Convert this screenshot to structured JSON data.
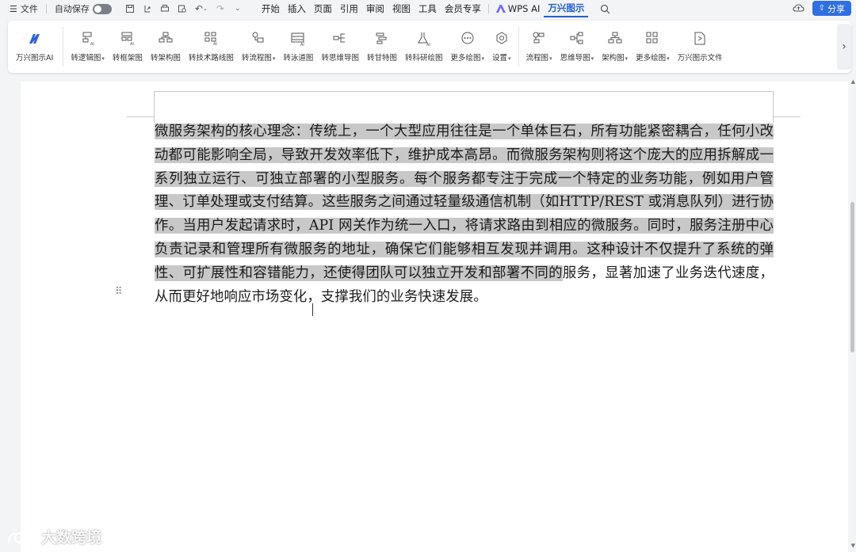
{
  "menubar": {
    "file_label": "文件",
    "autosave_label": "自动保存",
    "tabs": [
      {
        "label": "开始"
      },
      {
        "label": "插入"
      },
      {
        "label": "页面"
      },
      {
        "label": "引用"
      },
      {
        "label": "审阅"
      },
      {
        "label": "视图"
      },
      {
        "label": "工具"
      },
      {
        "label": "会员专享"
      },
      {
        "label": "WPS AI"
      },
      {
        "label": "万兴图示",
        "active": true
      }
    ],
    "share_label": "分享"
  },
  "ribbon": {
    "items": [
      {
        "label": "万兴图示AI",
        "icon": "ai-logo-icon"
      },
      {
        "label": "转逻辑图",
        "icon": "logic-diagram-icon",
        "dropdown": true
      },
      {
        "label": "转框架图",
        "icon": "frame-diagram-icon"
      },
      {
        "label": "转架构图",
        "icon": "architecture-diagram-icon"
      },
      {
        "label": "转技术路线图",
        "icon": "tech-roadmap-icon"
      },
      {
        "label": "转流程图",
        "icon": "flowchart-icon",
        "dropdown": true
      },
      {
        "label": "转泳道图",
        "icon": "swimlane-icon"
      },
      {
        "label": "转思维导图",
        "icon": "mindmap-icon"
      },
      {
        "label": "转甘特图",
        "icon": "gantt-icon"
      },
      {
        "label": "转科研绘图",
        "icon": "research-drawing-icon"
      },
      {
        "label": "更多绘图",
        "icon": "more-drawing-icon",
        "dropdown": true
      },
      {
        "label": "设置",
        "icon": "settings-icon",
        "dropdown": true
      },
      {
        "label": "流程图",
        "icon": "flowchart-insert-icon",
        "dropdown": true
      },
      {
        "label": "思维导图",
        "icon": "mindmap-insert-icon",
        "dropdown": true
      },
      {
        "label": "架构图",
        "icon": "architecture-insert-icon",
        "dropdown": true
      },
      {
        "label": "更多绘图",
        "icon": "more-insert-icon",
        "dropdown": true
      },
      {
        "label": "万兴图示文件",
        "icon": "diagram-file-icon"
      }
    ]
  },
  "document": {
    "selected_text": "微服务架构的核心理念：传统上，一个大型应用往往是一个单体巨石，所有功能紧密耦合，任何小改动都可能影响全局，导致开发效率低下，维护成本高昂。而微服务架构则将这个庞大的应用拆解成一系列独立运行、可独立部署的小型服务。每个服务都专注于完成一个特定的业务功能，例如用户管理、订单处理或支付结算。这些服务之间通过轻量级通信机制（如HTTP/REST 或消息队列）进行协作。当用户发起请求时，API 网关作为统一入口，将请求路由到相应的微服务。同时，服务注册中心负责记录和管理所有微服务的地址，确保它们能够相互发现并调用。这种设计不仅提升了系统的弹性、可扩展性和容错能力，还使得团队可以独立开发和部署不同的",
    "unselected_text": "服务，显著加速了业务迭代速度，从而更好地响应市场变化，支撑我们的业务快速发展。"
  },
  "watermark": {
    "text": "大数跨境"
  },
  "colors": {
    "accent": "#1f5fd1",
    "share_button": "#2f6fe0",
    "selection": "#c8c8c8"
  }
}
